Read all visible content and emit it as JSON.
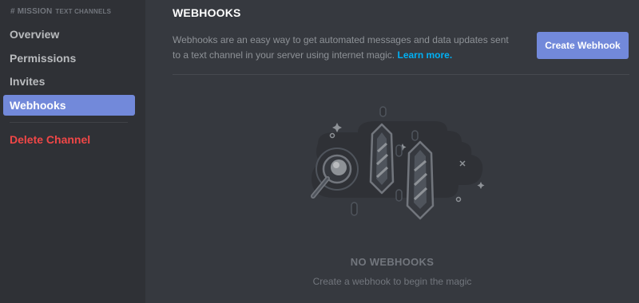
{
  "sidebar": {
    "channel_hash": "#",
    "channel_name": "MISSION",
    "channel_category": "TEXT CHANNELS",
    "items": [
      {
        "label": "Overview"
      },
      {
        "label": "Permissions"
      },
      {
        "label": "Invites"
      },
      {
        "label": "Webhooks",
        "selected": true
      }
    ],
    "delete_label": "Delete Channel"
  },
  "main": {
    "title": "WEBHOOKS",
    "description": "Webhooks are an easy way to get automated messages and data updates sent to a text channel in your server using internet magic.",
    "learn_more": "Learn more.",
    "create_button": "Create Webhook",
    "empty_title": "NO WEBHOOKS",
    "empty_subtitle": "Create a webhook to begin the magic"
  },
  "colors": {
    "background": "#36393f",
    "sidebar": "#2f3136",
    "accent": "#7289da",
    "danger": "#f04747",
    "link": "#00b0f4"
  },
  "icons": {
    "illustration": "magnifier-crystals-illustration"
  }
}
